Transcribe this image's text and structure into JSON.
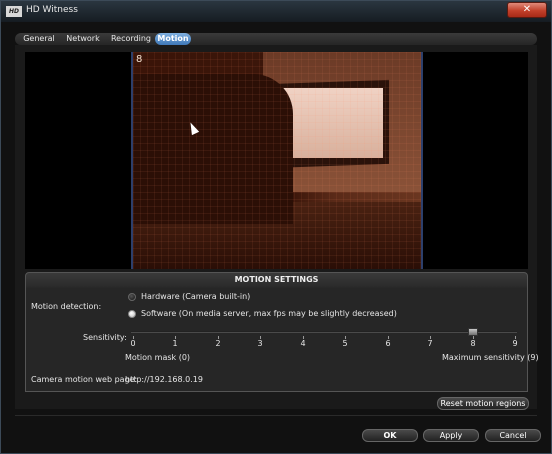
{
  "window": {
    "title": "HD Witness",
    "logo_text": "HD",
    "close_label": "✕"
  },
  "tabs": [
    {
      "label": "General",
      "active": false
    },
    {
      "label": "Network",
      "active": false
    },
    {
      "label": "Recording",
      "active": false
    },
    {
      "label": "Motion",
      "active": true
    }
  ],
  "video": {
    "channel_number": "8"
  },
  "motion_settings": {
    "title": "MOTION SETTINGS",
    "detection_label": "Motion detection:",
    "options": [
      {
        "label": "Hardware (Camera built-in)",
        "selected": false
      },
      {
        "label": "Software (On media server, max fps may be slightly decreased)",
        "selected": true
      }
    ],
    "sensitivity_label": "Sensitivity:",
    "sensitivity_ticks": [
      "0",
      "1",
      "2",
      "3",
      "4",
      "5",
      "6",
      "7",
      "8",
      "9"
    ],
    "sensitivity_value": 8,
    "min_label": "Motion mask (0)",
    "max_label": "Maximum sensitivity (9)",
    "web_page_label": "Camera motion web page:",
    "web_page_url": "http://192.168.0.19",
    "reset_button": "Reset motion regions"
  },
  "buttons": {
    "ok": "OK",
    "apply": "Apply",
    "cancel": "Cancel"
  },
  "colors": {
    "accent": "#3f78b8",
    "video_tint": "#5a2a18"
  }
}
